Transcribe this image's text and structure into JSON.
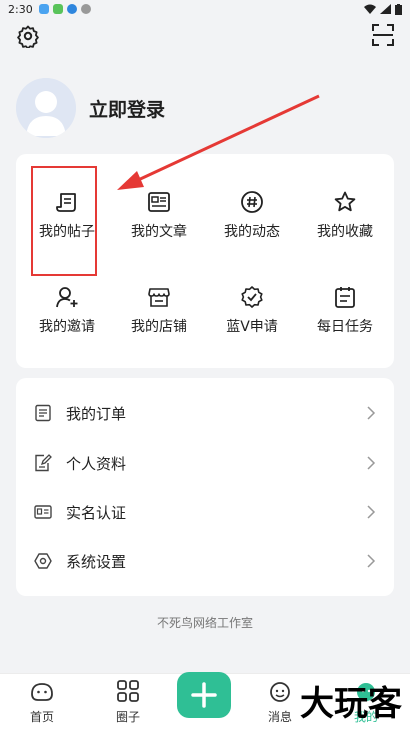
{
  "status_bar": {
    "time": "2:30"
  },
  "profile": {
    "login_label": "立即登录"
  },
  "grid": {
    "items": [
      {
        "label": "我的帖子",
        "icon": "post-icon"
      },
      {
        "label": "我的文章",
        "icon": "article-icon"
      },
      {
        "label": "我的动态",
        "icon": "hashtag-icon"
      },
      {
        "label": "我的收藏",
        "icon": "star-icon"
      },
      {
        "label": "我的邀请",
        "icon": "invite-icon"
      },
      {
        "label": "我的店铺",
        "icon": "shop-icon"
      },
      {
        "label": "蓝V申请",
        "icon": "verified-badge-icon"
      },
      {
        "label": "每日任务",
        "icon": "calendar-icon"
      }
    ]
  },
  "list": {
    "items": [
      {
        "label": "我的订单",
        "icon": "order-icon"
      },
      {
        "label": "个人资料",
        "icon": "profile-edit-icon"
      },
      {
        "label": "实名认证",
        "icon": "id-card-icon"
      },
      {
        "label": "系统设置",
        "icon": "settings-hex-icon"
      }
    ]
  },
  "footer": {
    "text": "不死鸟网络工作室"
  },
  "nav": {
    "items": [
      {
        "label": "首页",
        "icon": "home-icon"
      },
      {
        "label": "圈子",
        "icon": "grid-icon"
      },
      {
        "label": "消息",
        "icon": "message-icon"
      },
      {
        "label": "我的",
        "icon": "profile-icon"
      }
    ],
    "add_icon": "plus-icon"
  },
  "watermark": {
    "text": "大玩客"
  },
  "colors": {
    "accent": "#2fbf95",
    "highlight": "#e53935",
    "background": "#f2f3f5"
  }
}
